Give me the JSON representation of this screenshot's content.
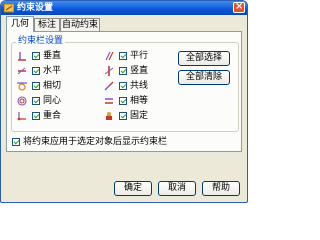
{
  "window": {
    "title": "约束设置"
  },
  "tabs": [
    {
      "label": "几何"
    },
    {
      "label": "标注"
    },
    {
      "label": "自动约束"
    }
  ],
  "group": {
    "title": "约束栏设置"
  },
  "constraints": {
    "left": [
      {
        "label": "垂直",
        "icon": "perpendicular-icon",
        "checked": true
      },
      {
        "label": "水平",
        "icon": "horizontal-icon",
        "checked": true
      },
      {
        "label": "相切",
        "icon": "tangent-icon",
        "checked": true
      },
      {
        "label": "同心",
        "icon": "concentric-icon",
        "checked": true
      },
      {
        "label": "重合",
        "icon": "coincident-icon",
        "checked": true
      }
    ],
    "right": [
      {
        "label": "平行",
        "icon": "parallel-icon",
        "checked": true
      },
      {
        "label": "竖直",
        "icon": "vertical-icon",
        "checked": true
      },
      {
        "label": "共线",
        "icon": "collinear-icon",
        "checked": true
      },
      {
        "label": "相等",
        "icon": "equal-icon",
        "checked": true
      },
      {
        "label": "固定",
        "icon": "fix-icon",
        "checked": true
      }
    ]
  },
  "buttons": {
    "select_all": "全部选择",
    "clear_all": "全部清除",
    "ok": "确定",
    "cancel": "取消",
    "help": "帮助"
  },
  "option": {
    "label": "将约束应用于选定对象后显示约束栏",
    "checked": true
  }
}
